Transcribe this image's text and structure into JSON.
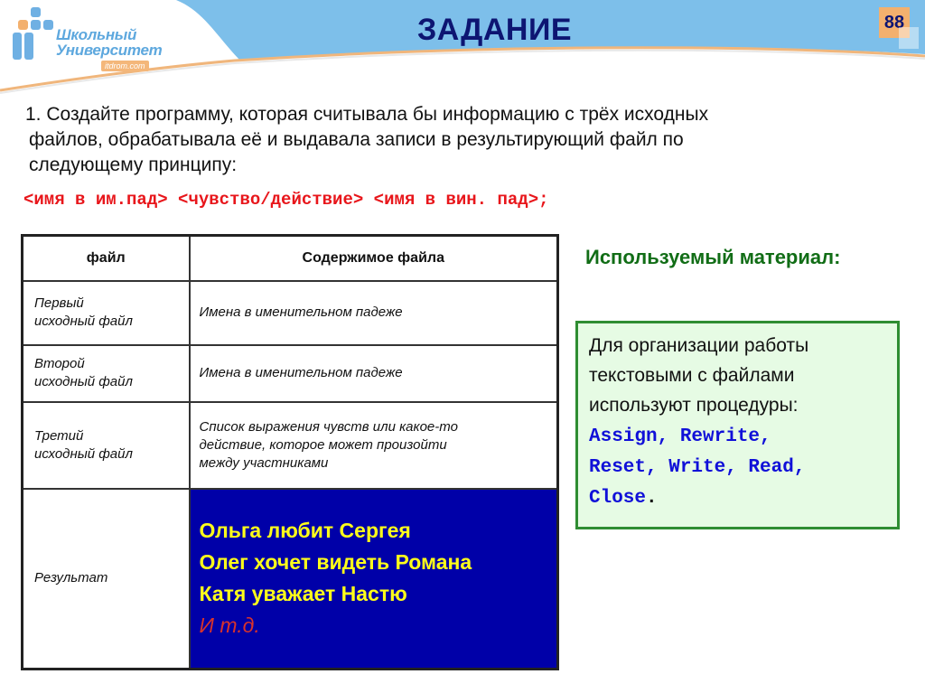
{
  "header": {
    "logo": {
      "line1": "Школьный",
      "line2": "Университет",
      "sub": "itdrom.com"
    },
    "title": "ЗАДАНИЕ",
    "page_number": "88"
  },
  "task": {
    "lines": [
      "1. Создайте программу, которая считывала бы информацию с трёх исходных",
      "файлов, обрабатывала её и выдавала записи в результирующий файл по",
      "следующему принципу:"
    ],
    "formula": "<имя в им.пад> <чувство/действие> <имя в вин. пад>;"
  },
  "table": {
    "headers": [
      "файл",
      "Содержимое файла"
    ],
    "rows": [
      {
        "file": [
          "Первый",
          "исходный файл"
        ],
        "content": "Имена в именительном падеже"
      },
      {
        "file": [
          "Второй",
          "исходный файл"
        ],
        "content": "Имена в именительном падеже"
      },
      {
        "file": [
          "Третий",
          "исходный файл"
        ],
        "content": [
          "Список выражения чувств или какое-то",
          "действие, которое может произойти",
          "между участниками"
        ]
      },
      {
        "file": [
          "Результат"
        ],
        "content": {
          "lines": [
            "Ольга любит Сергея",
            "Олег хочет видеть Романа",
            "Катя уважает Настю"
          ],
          "etc": "И т.д."
        }
      }
    ]
  },
  "material": {
    "title": "Используемый материал:",
    "text": [
      "Для организации работы",
      "текстовыми с файлами",
      "используют процедуры:"
    ],
    "code": [
      "Assign, Rewrite,",
      "Reset, Write, Read,",
      "Close"
    ],
    "code_end": "."
  },
  "colors": {
    "title": "#0d1572",
    "header_band": "#7dbfea",
    "accent_orange": "#f3b06e",
    "formula": "#e8161b",
    "result_bg": "#0000a8",
    "result_text": "#ffff1a",
    "material_title": "#116d16",
    "material_box_bg": "#e6fbe4",
    "code": "#1010d8"
  }
}
